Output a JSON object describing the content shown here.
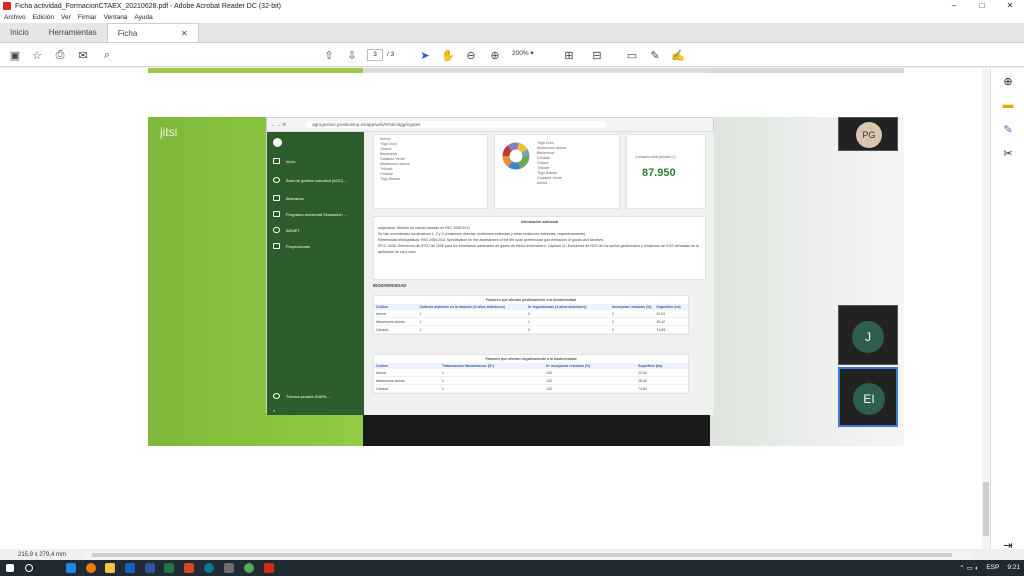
{
  "window": {
    "title": "Ficha actividad_FormacionCTAEX_20210628.pdf - Adobe Acrobat Reader DC (32-bit)"
  },
  "menu": [
    "Archivo",
    "Edición",
    "Ver",
    "Firmar",
    "Ventana",
    "Ayuda"
  ],
  "tabs": {
    "home": "Inicio",
    "tools": "Herramientas",
    "doc": "Ficha actividad_For..."
  },
  "toolbar": {
    "page_current": "3",
    "page_total": "/ 3",
    "zoom": "200%"
  },
  "meeting": {
    "app_name": "jitsi",
    "address": "agrogestion.prodevelop.es/app/web/#/calc/aggregates",
    "sidebar": [
      "Inicio",
      "Área de gestión colectiva (AGC) ...",
      "Itinerarios",
      "Programa ambiental Simulación ...",
      "AEMET",
      "Proyecciones"
    ],
    "user_label": "Técnico prueba IDAPA ...",
    "total_label": "Consumo total posible (L)",
    "total_value": "87.950",
    "info_title": "Información adicional",
    "info_lines": [
      "asignación: Método de cálculo basado en PAC 2050:2011",
      "Se han considerado los alcances 1, 2 y 3 (emisiones directas, emisiones indirectas y otras emisiones indirectas, respectivamente).",
      "Referencias bibliográficas: PAS 2050:2011 Specification for the assessment of the life cycle greenhouse gas emissions of goods and services.",
      "IPCC 2006: Directrices del IPCC de 2006 para los inventarios nacionales de gases de efecto invernadero. Capítulo 11: Emisiones de N2O de los suelos gestionados y emisiones de CO2 derivadas de la aplicación de cal y urea"
    ],
    "section_title": "BIODIVERSIDAD",
    "legend_labels": [
      "Avena",
      "Trigo Duro",
      "Girasol",
      "Barbechos",
      "Guisante Verde",
      "Altramuces dulces",
      "Triticale",
      "Cebada",
      "Trigo Blando"
    ],
    "table1": {
      "caption": "Factores que afectan positivamente a la biodiversidad",
      "headers": [
        "Cultivo",
        "Cultivos distintos en la rotación (4 años anteriores)",
        "Nº leguminosas (4 años anteriores)",
        "Incorporar residuos (%)",
        "Superficie (ha)"
      ],
      "rows": [
        [
          "Avena",
          "1",
          "0",
          "0",
          "22,04"
        ],
        [
          "Altramuces dulces",
          "1",
          "1",
          "0",
          "28,42"
        ],
        [
          "Cebada",
          "1",
          "0",
          "0",
          "74,83"
        ]
      ]
    },
    "table2": {
      "caption": "Factores que afectan negativamente a la biodiversidad",
      "headers": [
        "Cultivo",
        "Tratamientos fitosanitarios (Nº)",
        "Nº incorporar residuos (%)",
        "Superficie (ha)"
      ],
      "rows": [
        [
          "Avena",
          "1",
          "100",
          "22,04"
        ],
        [
          "Altramuces dulces",
          "2",
          "100",
          "28,42"
        ],
        [
          "Cebada",
          "2",
          "100",
          "74,83"
        ]
      ]
    },
    "participants": [
      {
        "initials": "PG"
      },
      {
        "initials": "J"
      },
      {
        "initials": "EI"
      }
    ]
  },
  "status": {
    "page_size": "215,9 x 279,4 mm"
  },
  "taskbar": {
    "language": "ESP",
    "time": "9:21"
  },
  "colors": {
    "accent_green": "#2e7d32",
    "sidebar_green": "#2d5d2d",
    "jitsi_green": "#88c43e"
  }
}
